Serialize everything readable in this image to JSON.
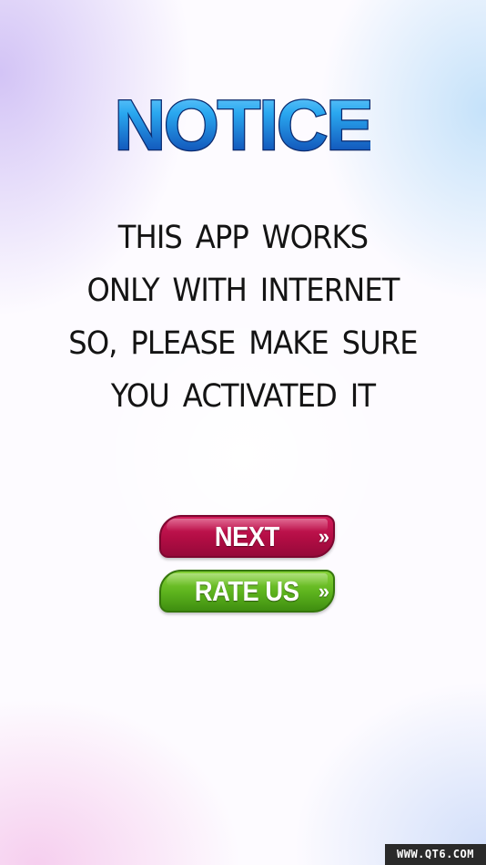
{
  "notice": {
    "title": "NOTICE",
    "title_colors": {
      "top": "#2aa8f0",
      "bottom": "#0a3aa8",
      "outline": "#0b2a6e"
    },
    "message_lines": [
      "THIS APP WORKS",
      "ONLY WITH INTERNET",
      "SO, PLEASE MAKE SURE",
      "YOU ACTIVATED IT"
    ]
  },
  "buttons": {
    "next": {
      "label": "NEXT",
      "arrow_icon": "»",
      "color": "#b20d44"
    },
    "rate_us": {
      "label": "RATE US",
      "arrow_icon": "»",
      "color": "#5cb21d"
    }
  },
  "watermark": {
    "text": "WWW.QT6.COM"
  }
}
